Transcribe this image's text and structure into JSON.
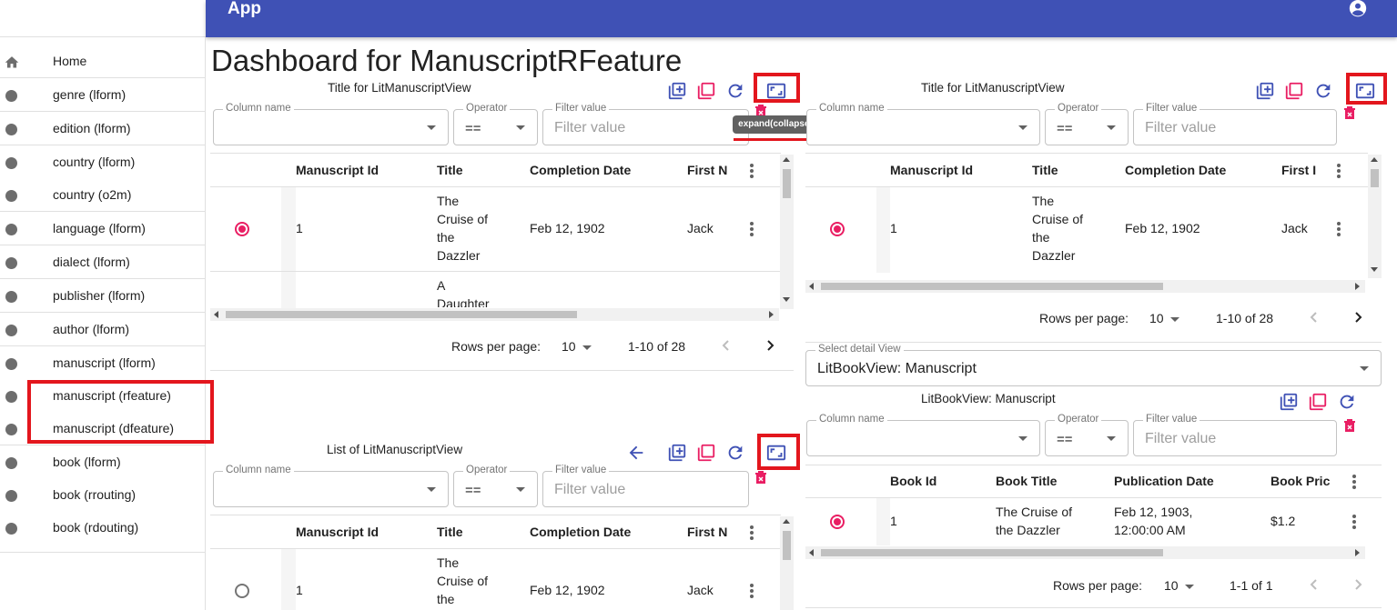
{
  "app": {
    "title": "App"
  },
  "sidebar": {
    "items": [
      {
        "label": "Home",
        "icon": "home-icon"
      },
      {
        "label": "genre (lform)",
        "icon": "dot-icon"
      },
      {
        "label": "edition (lform)",
        "icon": "dot-icon"
      },
      {
        "label": "country (lform)",
        "icon": "dot-icon"
      },
      {
        "label": "country (o2m)",
        "icon": "dot-icon"
      },
      {
        "label": "language (lform)",
        "icon": "dot-icon"
      },
      {
        "label": "dialect (lform)",
        "icon": "dot-icon"
      },
      {
        "label": "publisher (lform)",
        "icon": "dot-icon"
      },
      {
        "label": "author (lform)",
        "icon": "dot-icon"
      },
      {
        "label": "manuscript (lform)",
        "icon": "dot-icon"
      },
      {
        "label": "manuscript (rfeature)",
        "icon": "dot-icon"
      },
      {
        "label": "manuscript (dfeature)",
        "icon": "dot-icon"
      },
      {
        "label": "book (lform)",
        "icon": "dot-icon"
      },
      {
        "label": "book (rrouting)",
        "icon": "dot-icon"
      },
      {
        "label": "book (rdouting)",
        "icon": "dot-icon"
      }
    ]
  },
  "page": {
    "title": "Dashboard for ManuscriptRFeature"
  },
  "tooltip": "expand(collapse)",
  "filters": {
    "column_label": "Column name",
    "operator_label": "Operator",
    "operator_value": "==",
    "filter_label": "Filter value",
    "filter_placeholder": "Filter value"
  },
  "panel_a": {
    "title": "Title for LitManuscriptView",
    "columns": [
      "Manuscript Id",
      "Title",
      "Completion Date",
      "First N"
    ],
    "rows": [
      {
        "id": "1",
        "title_lines": [
          "The",
          "Cruise of",
          "the",
          "Dazzler"
        ],
        "date": "Feb 12, 1902",
        "first": "Jack",
        "selected": true
      },
      {
        "id": "",
        "title_lines": [
          "A",
          "Daughter"
        ],
        "date": "",
        "first": "",
        "selected": false
      }
    ],
    "pagination": {
      "rows_per_page_label": "Rows per page:",
      "rows_per_page": "10",
      "range": "1-10 of 28"
    }
  },
  "panel_b": {
    "title": "Title for LitManuscriptView",
    "columns": [
      "Manuscript Id",
      "Title",
      "Completion Date",
      "First I"
    ],
    "rows": [
      {
        "id": "1",
        "title_lines": [
          "The",
          "Cruise of",
          "the",
          "Dazzler"
        ],
        "date": "Feb 12, 1902",
        "first": "Jack",
        "selected": true
      }
    ],
    "pagination": {
      "rows_per_page_label": "Rows per page:",
      "rows_per_page": "10",
      "range": "1-10 of 28"
    }
  },
  "detail_select": {
    "label": "Select detail View",
    "value": "LitBookView: Manuscript"
  },
  "panel_c": {
    "title": "LitBookView: Manuscript",
    "columns": [
      "Book Id",
      "Book Title",
      "Publication Date",
      "Book Pric"
    ],
    "rows": [
      {
        "id": "1",
        "title_lines": [
          "The Cruise of",
          "the Dazzler"
        ],
        "date_lines": [
          "Feb 12, 1903,",
          "12:00:00 AM"
        ],
        "price": "$1.2",
        "selected": true
      }
    ],
    "pagination": {
      "rows_per_page_label": "Rows per page:",
      "rows_per_page": "10",
      "range": "1-1 of 1"
    }
  },
  "panel_d": {
    "title": "List of LitManuscriptView",
    "columns": [
      "Manuscript Id",
      "Title",
      "Completion Date",
      "First N"
    ],
    "rows": [
      {
        "id": "1",
        "title_lines": [
          "The",
          "Cruise of",
          "the"
        ],
        "date": "Feb 12, 1902",
        "first": "Jack",
        "selected": false
      }
    ]
  },
  "colors": {
    "primary": "#3f51b5",
    "accent": "#e91e63",
    "highlight": "#e3161d"
  }
}
